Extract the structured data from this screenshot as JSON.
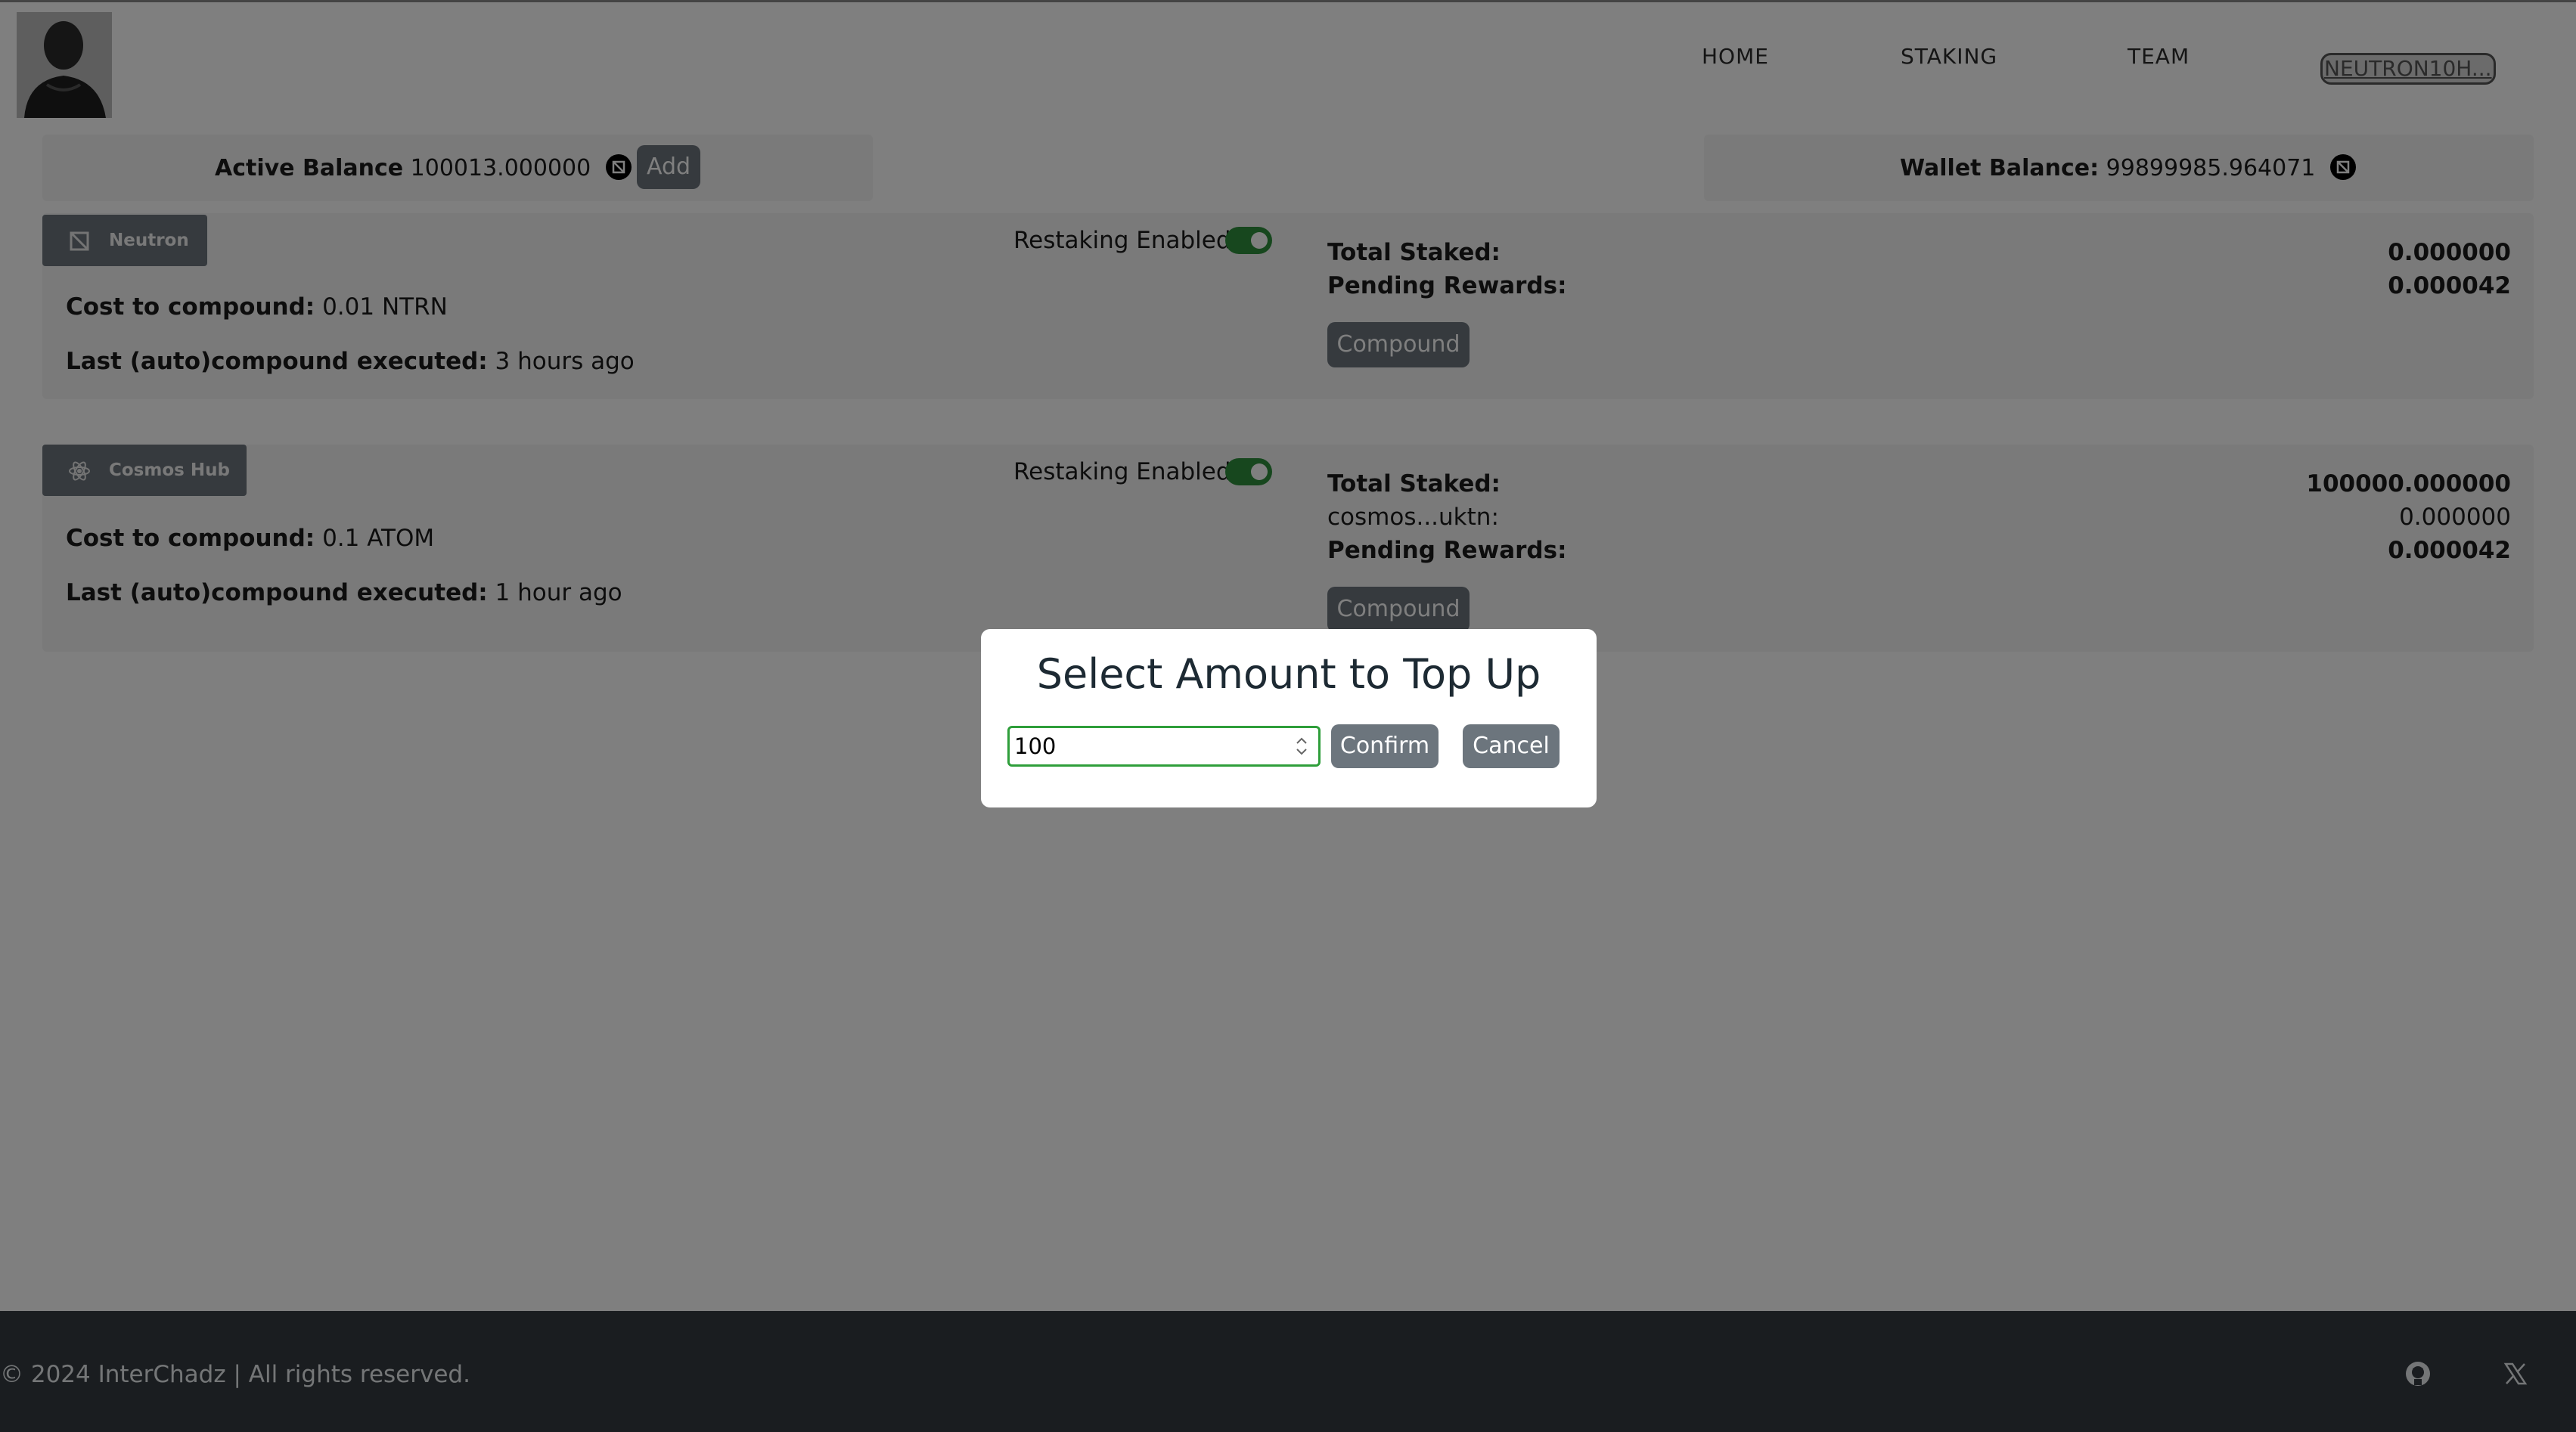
{
  "nav": {
    "home": "HOME",
    "staking": "STAKING",
    "team": "TEAM",
    "wallet_address": "NEUTRON10H..."
  },
  "balances": {
    "active_label": "Active Balance",
    "active_value": "100013.000000",
    "add_label": "Add",
    "wallet_label": "Wallet Balance:",
    "wallet_value": "99899985.964071"
  },
  "chains": [
    {
      "name": "Neutron",
      "icon": "neutron-icon",
      "restaking_label": "Restaking Enabled:",
      "restaking_enabled": true,
      "cost_label": "Cost to compound:",
      "cost_value": "0.01 NTRN",
      "last_label": "Last (auto)compound executed:",
      "last_value": "3 hours ago",
      "total_staked_label": "Total Staked:",
      "total_staked_value": "0.000000",
      "pending_label": "Pending Rewards:",
      "pending_value": "0.000042",
      "compound_label": "Compound"
    },
    {
      "name": "Cosmos Hub",
      "icon": "cosmos-hub-icon",
      "restaking_label": "Restaking Enabled:",
      "restaking_enabled": true,
      "cost_label": "Cost to compound:",
      "cost_value": "0.1 ATOM",
      "last_label": "Last (auto)compound executed:",
      "last_value": "1 hour ago",
      "total_staked_label": "Total Staked:",
      "total_staked_value": "100000.000000",
      "validator_label": "cosmos...uktn:",
      "validator_value": "0.000000",
      "pending_label": "Pending Rewards:",
      "pending_value": "0.000042",
      "compound_label": "Compound"
    }
  ],
  "footer": {
    "copyright": "© 2024 InterChadz | All rights reserved.",
    "icons": [
      "github-icon",
      "x-twitter-icon"
    ]
  },
  "modal": {
    "title": "Select Amount to Top Up",
    "amount_value": "100",
    "confirm_label": "Confirm",
    "cancel_label": "Cancel"
  },
  "colors": {
    "toggle_on": "#2f8f3d",
    "button": "#6c757d",
    "footer_bg": "#343a40",
    "input_focus": "#2e9e3a"
  }
}
